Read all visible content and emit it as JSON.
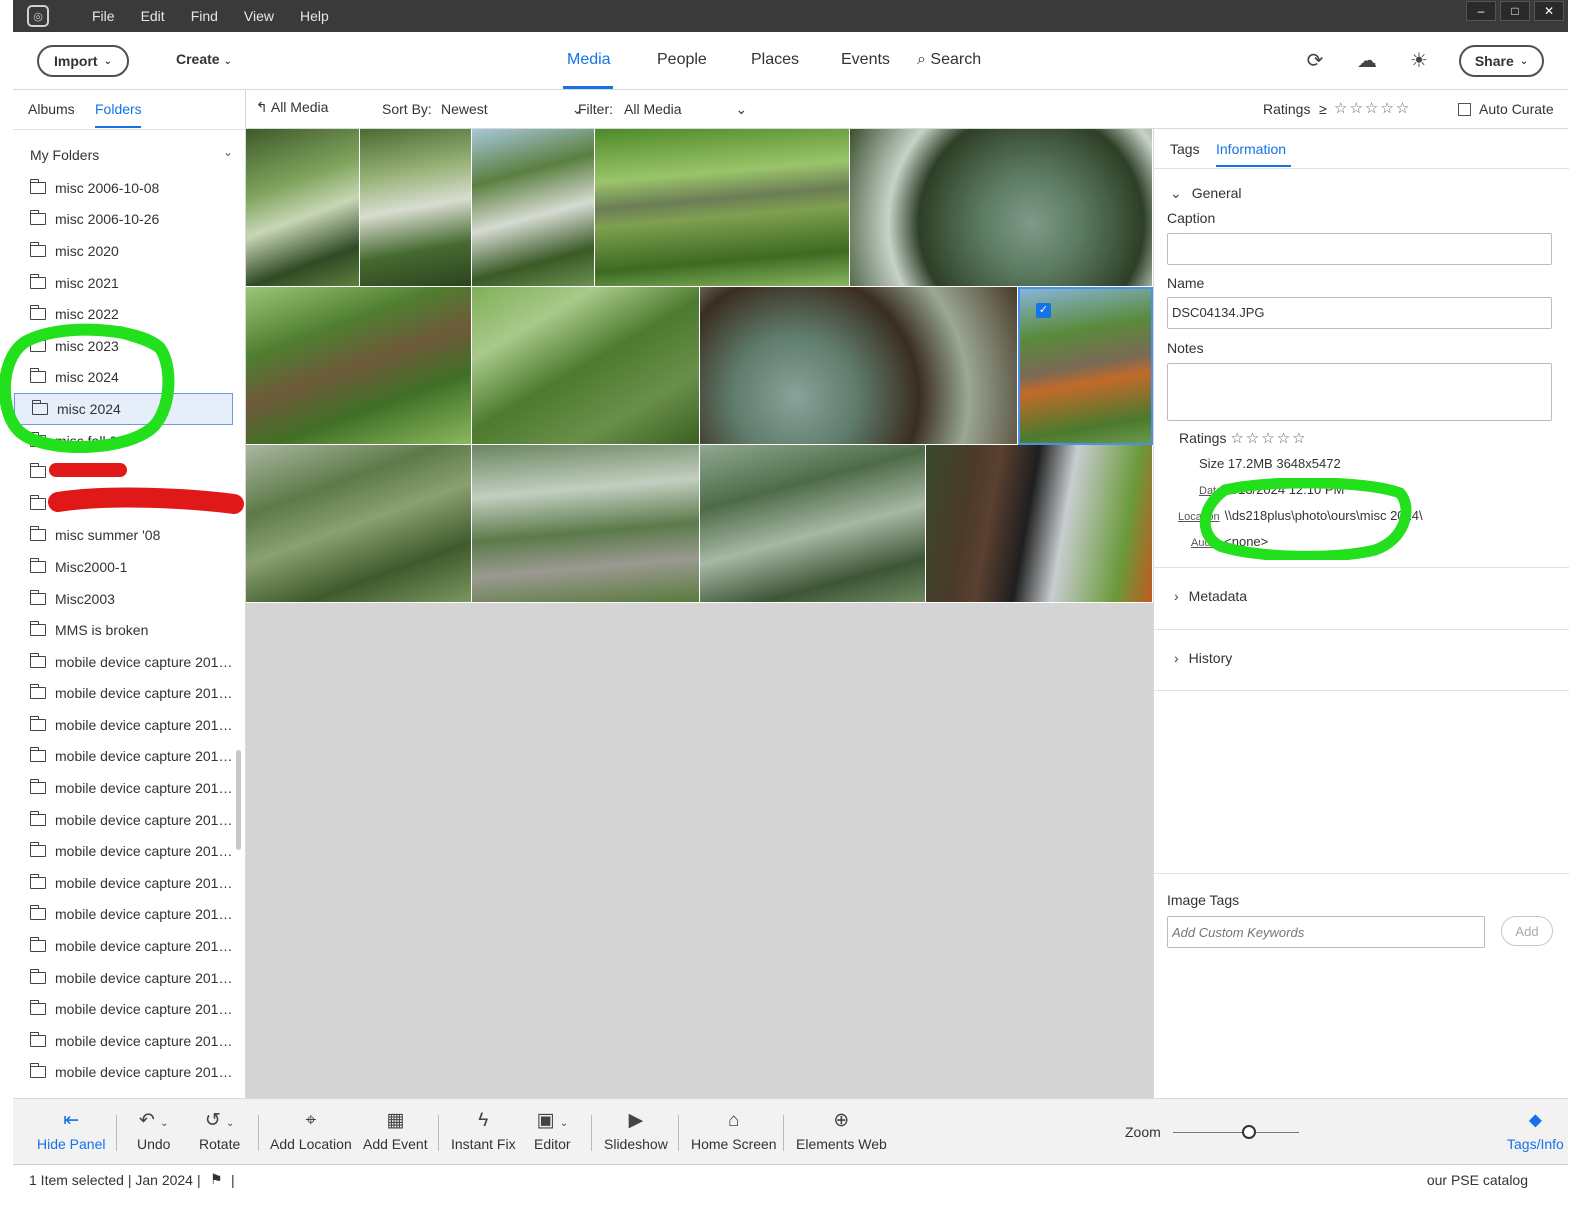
{
  "menu": [
    "File",
    "Edit",
    "Find",
    "View",
    "Help"
  ],
  "window_controls": {
    "minimize": "–",
    "maximize": "□",
    "close": "✕"
  },
  "topnav": {
    "import": "Import",
    "create": "Create",
    "tabs": [
      "Media",
      "People",
      "Places",
      "Events"
    ],
    "search": "Search",
    "share": "Share"
  },
  "left_panel": {
    "tabs": [
      "Albums",
      "Folders"
    ],
    "section": "My Folders",
    "folders": [
      "misc 2006-10-08",
      "misc 2006-10-26",
      "misc 2020",
      "misc 2021",
      "misc 2022",
      "misc 2023",
      "misc 2024",
      "misc 2024",
      "misc fall 06",
      "",
      "",
      "misc summer '08",
      "Misc2000-1",
      "Misc2003",
      "MMS is broken",
      "mobile device capture 2012...",
      "mobile device capture 2012...",
      "mobile device capture 2012...",
      "mobile device capture 2012...",
      "mobile device capture 2013...",
      "mobile device capture 2013...",
      "mobile device capture 2013...",
      "mobile device capture 2014...",
      "mobile device capture 2015...",
      "mobile device capture 2015...",
      "mobile device capture 2015...",
      "mobile device capture 2015...",
      "mobile device capture 2015...",
      "mobile device capture 2015..."
    ],
    "selected_index": 7
  },
  "media_bar": {
    "all_media": "All Media",
    "sort_label": "Sort By:",
    "sort_value": "Newest",
    "filter_label": "Filter:",
    "filter_value": "All Media",
    "ratings_label": "Ratings",
    "ratings_op": "≥",
    "stars": "☆☆☆☆☆",
    "auto_curate": "Auto Curate"
  },
  "right_panel": {
    "tabs": [
      "Tags",
      "Information"
    ],
    "general": "General",
    "caption_label": "Caption",
    "caption_value": "",
    "name_label": "Name",
    "name_value": "DSC04134.JPG",
    "notes_label": "Notes",
    "notes_value": "",
    "ratings_label": "Ratings",
    "stars": "☆☆☆☆☆",
    "size_label": "Size",
    "size_value": "17.2MB  3648x5472",
    "date_label": "Date",
    "date_value": "1/13/2024 12:10 PM",
    "location_label": "Location",
    "location_value": "\\\\ds218plus\\photo\\ours\\misc 2024\\",
    "audio_label": "Audio",
    "audio_value": "<none>",
    "metadata": "Metadata",
    "history": "History",
    "image_tags_label": "Image Tags",
    "keywords_placeholder": "Add Custom Keywords",
    "add_button": "Add"
  },
  "bottom_toolbar": {
    "hide_panel": "Hide Panel",
    "undo": "Undo",
    "rotate": "Rotate",
    "add_location": "Add Location",
    "add_event": "Add Event",
    "instant_fix": "Instant Fix",
    "editor": "Editor",
    "slideshow": "Slideshow",
    "home_screen": "Home Screen",
    "elements_web": "Elements Web",
    "zoom": "Zoom",
    "tags_info": "Tags/Info"
  },
  "status": {
    "selection": "1 Item selected | Jan 2024",
    "catalog": "our PSE catalog"
  },
  "colors": {
    "accent": "#1473e6",
    "annotation_green": "#22e01b",
    "redaction_red": "#e01818"
  },
  "icons": [
    "app-logo-icon",
    "chevron-down-icon",
    "search-icon",
    "sync-icon",
    "cloud-icon",
    "brightness-icon",
    "folder-icon",
    "back-arrow-icon",
    "checkbox-icon",
    "star-icon",
    "hide-panel-icon",
    "undo-icon",
    "rotate-icon",
    "add-location-icon",
    "add-event-icon",
    "instant-fix-icon",
    "editor-icon",
    "slideshow-icon",
    "home-icon",
    "globe-icon",
    "tag-icon",
    "flag-icon"
  ]
}
